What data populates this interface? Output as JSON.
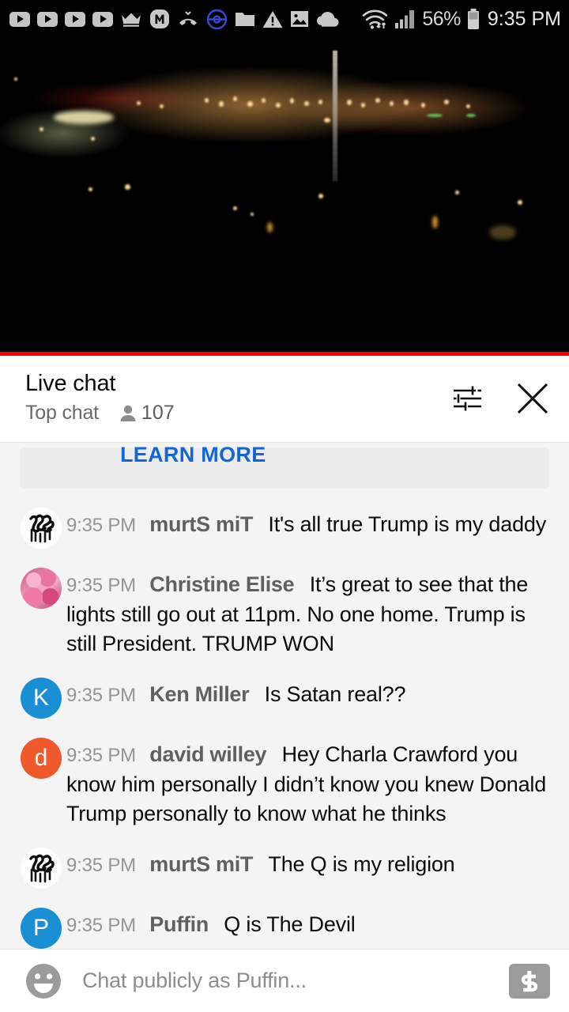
{
  "statusbar": {
    "icons": [
      {
        "name": "youtube-play-icon-1",
        "glyph": "youtube"
      },
      {
        "name": "youtube-play-icon-2",
        "glyph": "youtube"
      },
      {
        "name": "youtube-play-icon-3",
        "glyph": "youtube"
      },
      {
        "name": "youtube-play-icon-4",
        "glyph": "youtube"
      },
      {
        "name": "crown-icon",
        "glyph": "crown"
      },
      {
        "name": "m-badge-icon",
        "glyph": "m-circle"
      },
      {
        "name": "missed-call-icon",
        "glyph": "missed-call"
      },
      {
        "name": "pokeball-icon",
        "glyph": "pokeball"
      },
      {
        "name": "folder-icon",
        "glyph": "folder"
      },
      {
        "name": "warning-triangle-icon",
        "glyph": "warning"
      },
      {
        "name": "image-icon",
        "glyph": "image"
      },
      {
        "name": "cloud-icon",
        "glyph": "cloud"
      }
    ],
    "wifi_icon": "wifi-transfer-icon",
    "signal_icon": "cellular-signal-icon",
    "battery_percent": "56%",
    "battery_icon": "battery-icon",
    "time": "9:35 PM"
  },
  "video": {
    "name": "live-video-player",
    "description": "Night cityscape livestream",
    "progress_color": "#ff0000",
    "progress_percent": 100
  },
  "chat_header": {
    "title": "Live chat",
    "subtitle": "Top chat",
    "viewer_count": "107",
    "viewer_icon": "person-icon",
    "settings_icon": "tune-sliders-icon",
    "close_icon": "close-icon"
  },
  "banner": {
    "link_label": "LEARN MORE"
  },
  "messages": [
    {
      "avatar_type": "graffiti",
      "avatar_label": "",
      "avatar_color": "#fbfbfb",
      "time": "9:35 PM",
      "author": "murtS miT",
      "text": "It's all true Trump is my daddy"
    },
    {
      "avatar_type": "roses",
      "avatar_label": "",
      "avatar_color": "#e8739e",
      "time": "9:35 PM",
      "author": "Christine Elise",
      "text": "It’s great to see that the lights still go out at 11pm. No one home. Trump is still President. TRUMP WON"
    },
    {
      "avatar_type": "initial",
      "avatar_label": "K",
      "avatar_color": "#1a8fd4",
      "time": "9:35 PM",
      "author": "Ken Miller",
      "text": "Is Satan real??"
    },
    {
      "avatar_type": "initial",
      "avatar_label": "d",
      "avatar_color": "#f0592b",
      "time": "9:35 PM",
      "author": "david willey",
      "text": "Hey Charla Crawford you know him personally I didn’t know you knew Donald Trump personally to know what he thinks"
    },
    {
      "avatar_type": "graffiti",
      "avatar_label": "",
      "avatar_color": "#fbfbfb",
      "time": "9:35 PM",
      "author": "murtS miT",
      "text": "The Q is my religion"
    },
    {
      "avatar_type": "initial",
      "avatar_label": "P",
      "avatar_color": "#1a8fd4",
      "time": "9:35 PM",
      "author": "Puffin",
      "text": "Q is The Devil"
    }
  ],
  "chat_input": {
    "emoji_icon": "emoji-smiley-icon",
    "placeholder": "Chat publicly as Puffin...",
    "superchat_icon": "dollar-sign-icon"
  }
}
